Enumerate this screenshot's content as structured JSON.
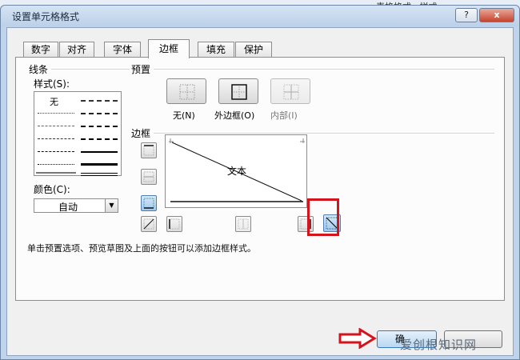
{
  "dialog": {
    "title": "设置单元格格式",
    "help_label": "?",
    "close_label": "x"
  },
  "tabs": [
    {
      "label": "数字"
    },
    {
      "label": "对齐"
    },
    {
      "label": "字体"
    },
    {
      "label": "边框",
      "active": true
    },
    {
      "label": "填充"
    },
    {
      "label": "保护"
    }
  ],
  "line_group": {
    "title": "线条",
    "style_label": "样式(S):",
    "none_label": "无",
    "color_label": "颜色(C):",
    "color_value": "自动"
  },
  "presets": {
    "title": "预置",
    "items": [
      {
        "label": "无(N)"
      },
      {
        "label": "外边框(O)"
      },
      {
        "label": "内部(I)"
      }
    ]
  },
  "border_group": {
    "title": "边框",
    "preview_text": "文本"
  },
  "hint": "单击预置选项、预览草图及上面的按钮可以添加边框样式。",
  "buttons": {
    "ok_label": "确"
  },
  "background": {
    "text_right": "表格格式 · 样式 ·"
  },
  "watermark": "爱创根知识网",
  "colors": {
    "highlight": "#d3141c",
    "title_bar": "#bcd0e8",
    "selected_button": "#9ec8ee"
  }
}
